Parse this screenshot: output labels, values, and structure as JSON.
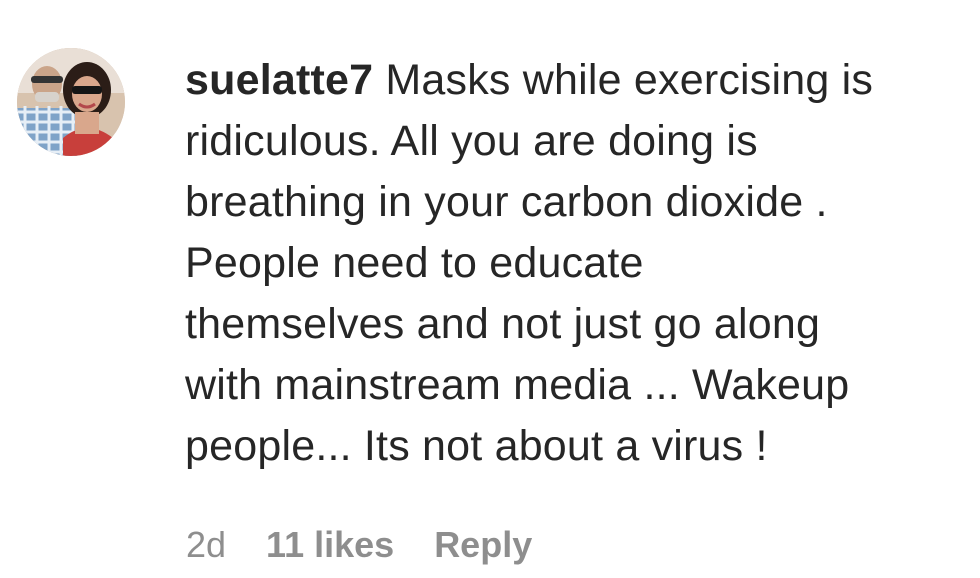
{
  "comment": {
    "username": "suelatte7",
    "text_lines": [
      "Masks while exercising is",
      "ridiculous. All you are doing is",
      "breathing in your carbon dioxide .",
      "People need to educate",
      "themselves and not just go along",
      "with mainstream media ... Wakeup",
      "people... Its not about a virus !"
    ],
    "time_ago": "2d",
    "likes": "11 likes",
    "reply_label": "Reply"
  },
  "colors": {
    "text": "#262626",
    "meta": "#8e8e8e",
    "background": "#ffffff"
  },
  "icons": {
    "avatar": "profile-photo"
  }
}
